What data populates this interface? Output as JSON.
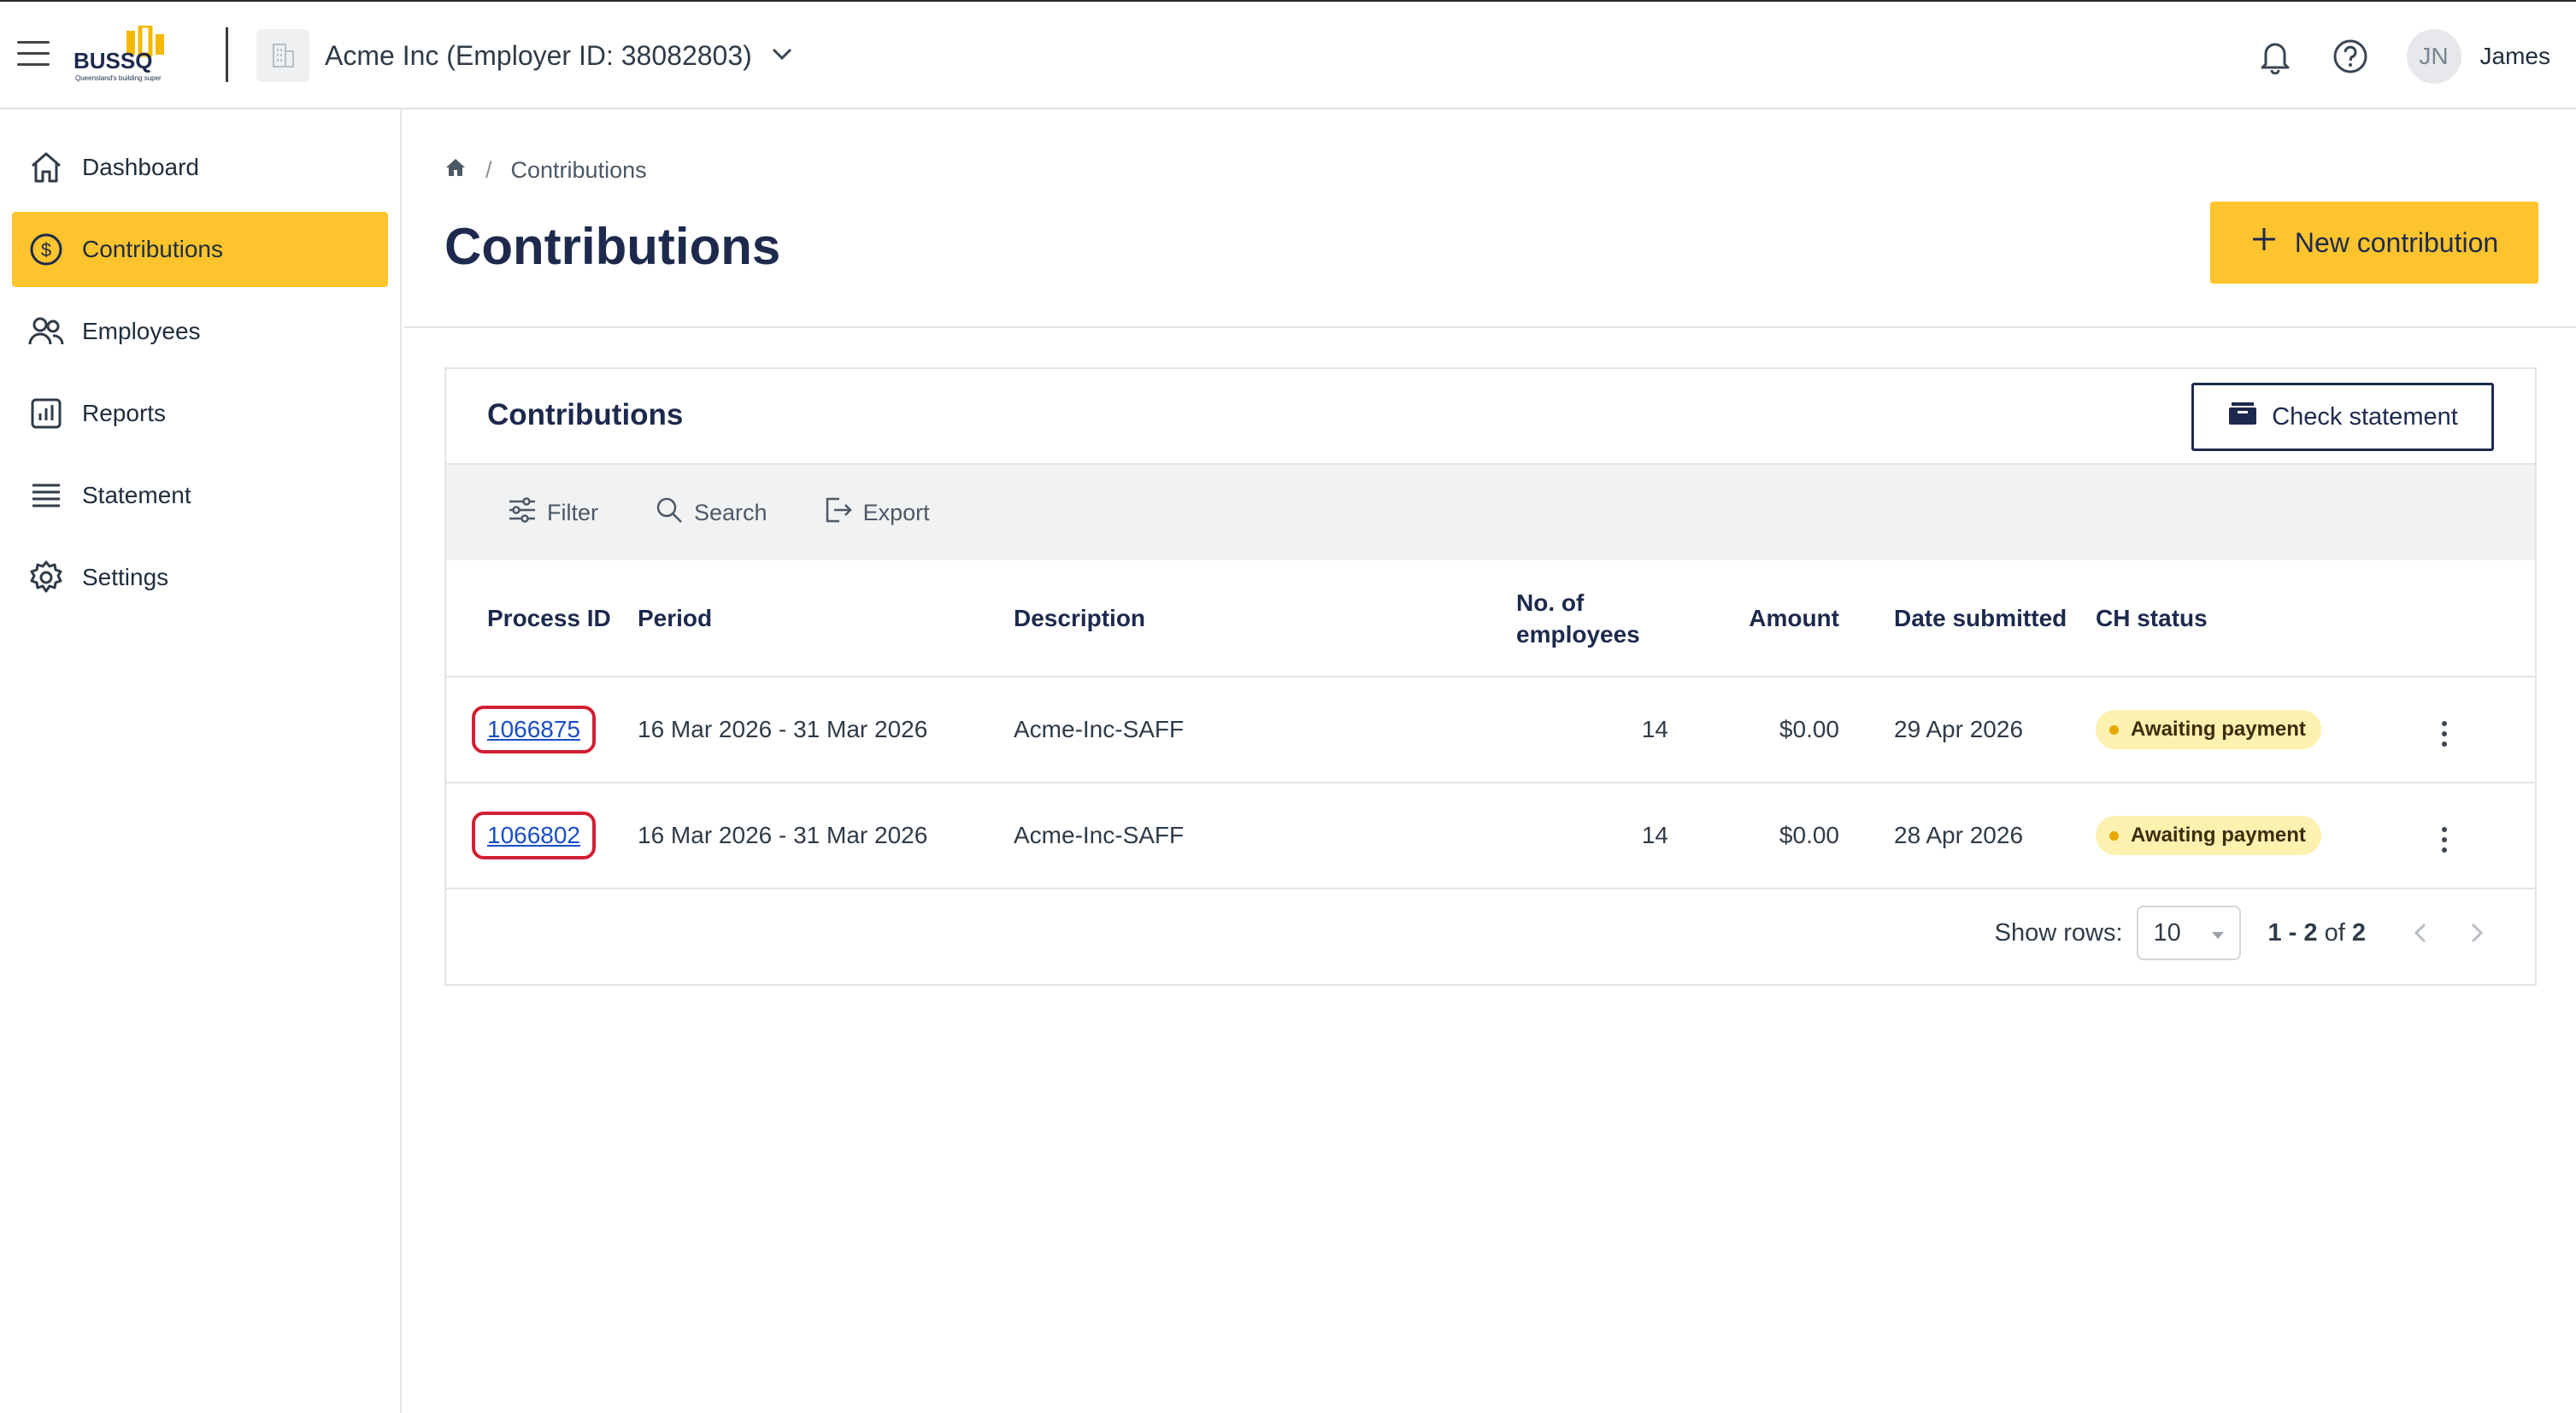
{
  "header": {
    "logo_text": "BUSSQ",
    "logo_tagline": "Queensland's building super",
    "employer_name": "Acme Inc",
    "employer_id": "(Employer ID: 38082803)",
    "user_initials": "JN",
    "user_name": "James"
  },
  "sidebar": {
    "items": [
      {
        "label": "Dashboard",
        "icon": "home-icon"
      },
      {
        "label": "Contributions",
        "icon": "dollar-circle-icon",
        "active": true
      },
      {
        "label": "Employees",
        "icon": "people-icon"
      },
      {
        "label": "Reports",
        "icon": "bar-chart-icon"
      },
      {
        "label": "Statement",
        "icon": "list-icon"
      },
      {
        "label": "Settings",
        "icon": "gear-icon"
      }
    ]
  },
  "page": {
    "breadcrumb_current": "Contributions",
    "title": "Contributions",
    "new_button": "New contribution"
  },
  "card": {
    "title": "Contributions",
    "check_statement": "Check statement",
    "toolbar": {
      "filter": "Filter",
      "search": "Search",
      "export": "Export"
    },
    "columns": {
      "process_id": "Process ID",
      "period": "Period",
      "description": "Description",
      "employees_line1": "No. of",
      "employees_line2": "employees",
      "amount": "Amount",
      "date_submitted": "Date submitted",
      "ch_status": "CH status"
    },
    "rows": [
      {
        "process_id": "1066875",
        "period": "16 Mar 2026 - 31 Mar 2026",
        "description": "Acme-Inc-SAFF",
        "employees": "14",
        "amount": "$0.00",
        "date_submitted": "29 Apr 2026",
        "status": "Awaiting payment"
      },
      {
        "process_id": "1066802",
        "period": "16 Mar 2026 - 31 Mar 2026",
        "description": "Acme-Inc-SAFF",
        "employees": "14",
        "amount": "$0.00",
        "date_submitted": "28 Apr 2026",
        "status": "Awaiting payment"
      }
    ],
    "pager": {
      "show_rows_label": "Show rows:",
      "rows_value": "10",
      "range": "1 - 2",
      "of_text": "of",
      "total": "2"
    }
  },
  "colors": {
    "accent": "#fec42d",
    "navy": "#1d2a4d",
    "highlight": "#d21f32",
    "badge_bg": "#fdf1b0"
  }
}
